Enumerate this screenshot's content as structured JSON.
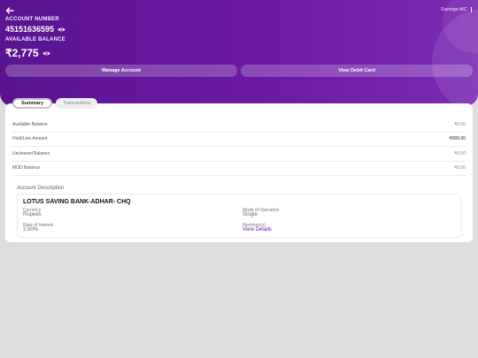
{
  "header": {
    "account_type": "Savings A/C",
    "account_number_label": "ACCOUNT NUMBER",
    "account_number": "45151636595",
    "available_balance_label": "AVAILABLE BALANCE",
    "available_balance": "₹2,775",
    "manage_account_label": "Manage Account",
    "view_debit_card_label": "View Debit Card",
    "accent_color": "#6b1aa6"
  },
  "tabs": [
    {
      "label": "Summary",
      "active": true
    },
    {
      "label": "Transactions",
      "active": false
    }
  ],
  "summary_rows": [
    {
      "label": "Available Balance",
      "value": "₹0.00"
    },
    {
      "label": "Hold/Lien Amount",
      "value": "₹000.00"
    },
    {
      "label": "Uncleared Balance",
      "value": "₹0.00"
    },
    {
      "label": "MOD Balance",
      "value": "₹0.00"
    }
  ],
  "account_description": {
    "title": "Account Description",
    "name": "LOTUS SAVING BANK-ADHAR- CHQ",
    "currency_label": "Currency",
    "currency": "Rupees",
    "mode_label": "Mode of Operation",
    "mode": "Single",
    "interest_label": "Rate of Interest",
    "interest": "2.50%",
    "nominee_label": "Nominee(s)",
    "nominee_link": "View Details"
  },
  "icons": [
    "back-arrow-icon",
    "eye-icon",
    "eye-icon",
    "more-vertical-icon"
  ]
}
